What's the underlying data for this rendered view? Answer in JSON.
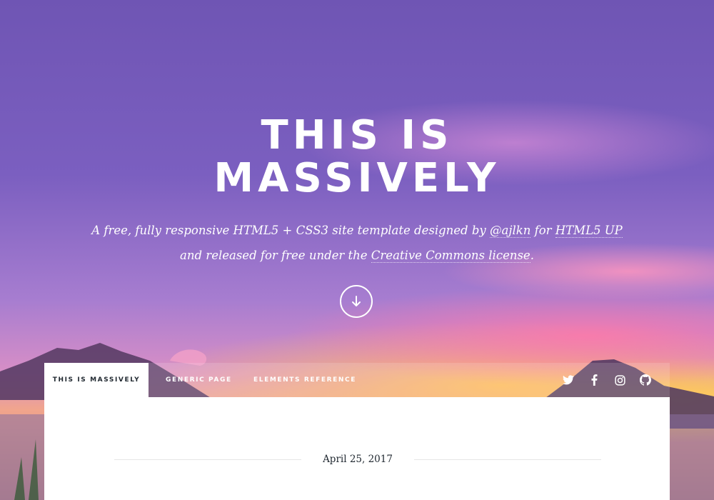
{
  "hero": {
    "title_line1": "THIS IS",
    "title_line2": "MASSIVELY",
    "subtitle_line1_pre": "A free, fully responsive HTML5 + CSS3 site template designed by ",
    "subtitle_line1_link1": "@ajlkn",
    "subtitle_line1_mid": " for ",
    "subtitle_line1_link2": "HTML5 UP",
    "subtitle_line2_pre": "and released for free under the ",
    "subtitle_line2_link": "Creative Commons license",
    "subtitle_line2_post": "."
  },
  "scroll_button": {
    "icon": "arrow-down-icon"
  },
  "nav": {
    "items": [
      {
        "label": "This is Massively",
        "active": true
      },
      {
        "label": "Generic Page",
        "active": false
      },
      {
        "label": "Elements Reference",
        "active": false
      }
    ],
    "social": [
      "twitter-icon",
      "facebook-icon",
      "instagram-icon",
      "github-icon"
    ]
  },
  "post": {
    "date": "April 25, 2017"
  },
  "colors": {
    "text_dark": "#212931",
    "white": "#ffffff",
    "sky_purple": "#7b5fc0"
  }
}
